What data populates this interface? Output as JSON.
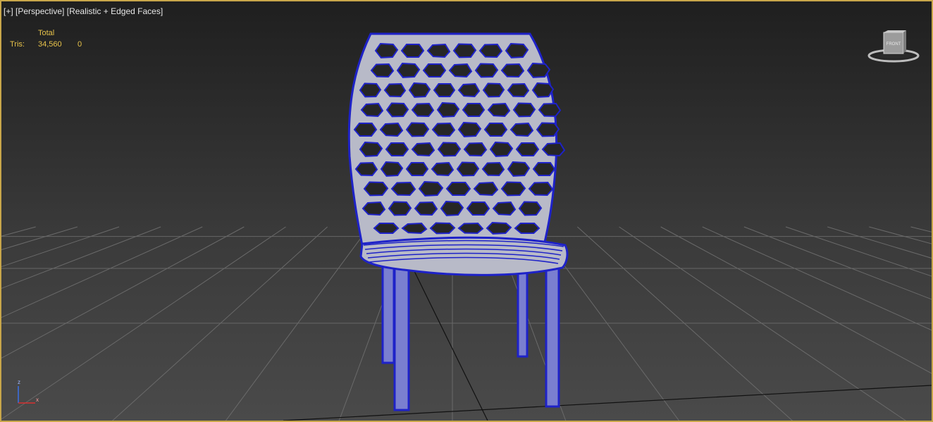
{
  "viewport": {
    "label_plus": "[+]",
    "label_view": "[Perspective]",
    "label_shading": "[Realistic + Edged Faces]"
  },
  "stats": {
    "header": "Total",
    "row_label": "Tris:",
    "row_value": "34,560",
    "row_selected": "0"
  },
  "viewcube": {
    "face_label": "FRONT"
  },
  "axis_tripod": {
    "z_label": "z",
    "x_label": "x"
  },
  "colors": {
    "wire": "#1e22c8",
    "surface": "#c9cbd6",
    "grid": "#6e6e6e",
    "accent": "#c8a64a",
    "stats_text": "#e8c34a"
  }
}
